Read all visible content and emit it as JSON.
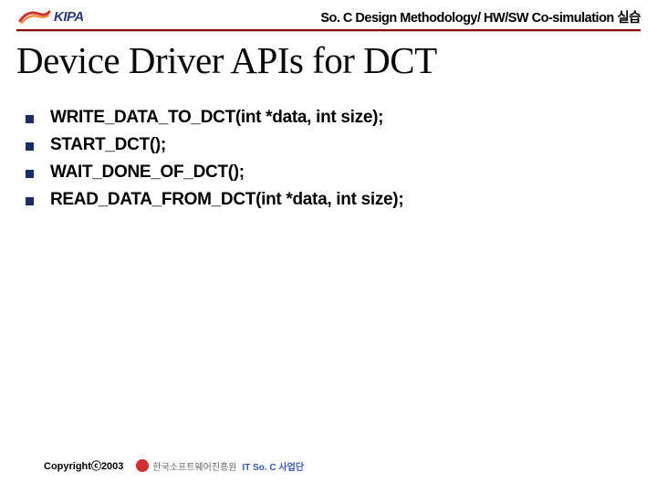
{
  "header": {
    "logo_brand": "KIPA",
    "breadcrumb": "So. C Design Methodology/ HW/SW Co-simulation 실습"
  },
  "title": "Device Driver APIs for DCT",
  "items": [
    "WRITE_DATA_TO_DCT(int *data, int size);",
    "START_DCT();",
    "WAIT_DONE_OF_DCT();",
    "READ_DATA_FROM_DCT(int *data, int size);"
  ],
  "footer": {
    "copyright": "Copyrightⓒ2003",
    "org_korean": "한국소프트웨어진흥원",
    "org_suffix": "IT So. C 사업단"
  }
}
